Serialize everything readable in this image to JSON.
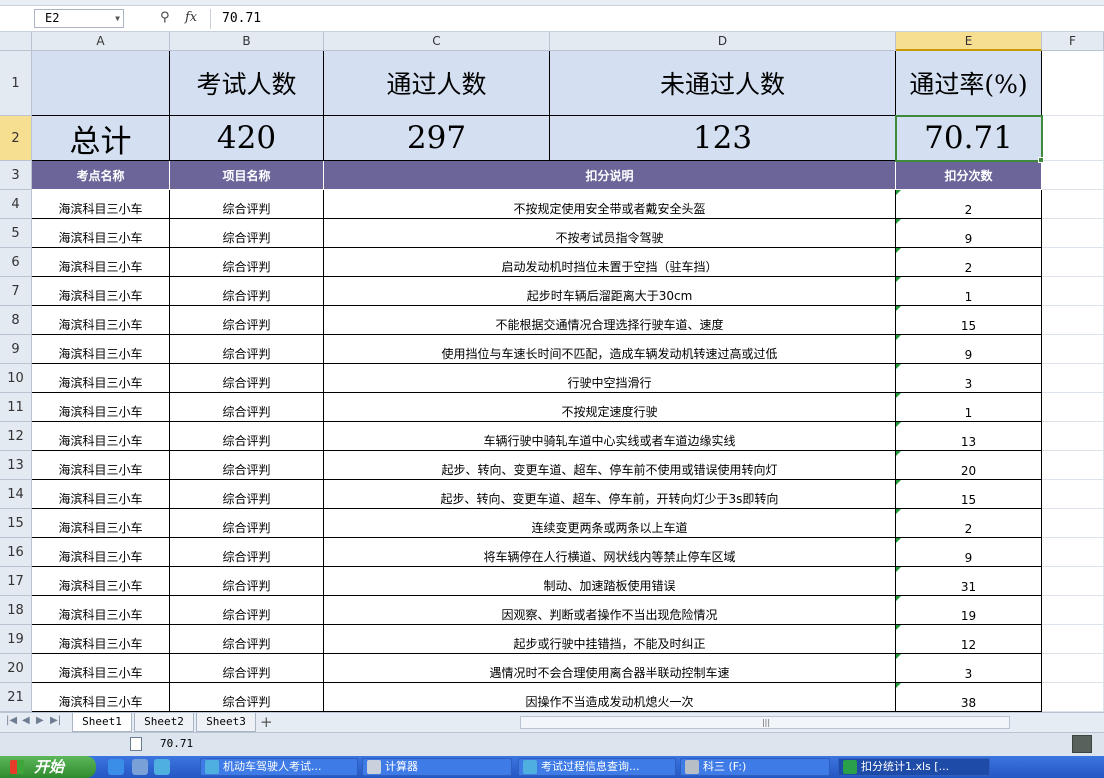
{
  "formula_bar": {
    "name_box": "E2",
    "fx_label": "fx",
    "formula_value": "70.71"
  },
  "columns": [
    "A",
    "B",
    "C",
    "D",
    "E",
    "F"
  ],
  "row_numbers": [
    "1",
    "2",
    "3",
    "4",
    "5",
    "6",
    "7",
    "8",
    "9",
    "10",
    "11",
    "12",
    "13",
    "14",
    "15",
    "16",
    "17",
    "18",
    "19",
    "20",
    "21"
  ],
  "summary": {
    "headers": [
      "",
      "考试人数",
      "通过人数",
      "未通过人数",
      "通过率(%)"
    ],
    "values": [
      "总计",
      "420",
      "297",
      "123",
      "70.71"
    ]
  },
  "table": {
    "headers": [
      "考点名称",
      "项目名称",
      "扣分说明",
      "扣分次数"
    ],
    "rows": [
      [
        "海滨科目三小车",
        "综合评判",
        "不按规定使用安全带或者戴安全头盔",
        "2"
      ],
      [
        "海滨科目三小车",
        "综合评判",
        "不按考试员指令驾驶",
        "9"
      ],
      [
        "海滨科目三小车",
        "综合评判",
        "启动发动机时挡位未置于空挡（驻车挡）",
        "2"
      ],
      [
        "海滨科目三小车",
        "综合评判",
        "起步时车辆后溜距离大于30cm",
        "1"
      ],
      [
        "海滨科目三小车",
        "综合评判",
        "不能根据交通情况合理选择行驶车道、速度",
        "15"
      ],
      [
        "海滨科目三小车",
        "综合评判",
        "使用挡位与车速长时间不匹配，造成车辆发动机转速过高或过低",
        "9"
      ],
      [
        "海滨科目三小车",
        "综合评判",
        "行驶中空挡滑行",
        "3"
      ],
      [
        "海滨科目三小车",
        "综合评判",
        "不按规定速度行驶",
        "1"
      ],
      [
        "海滨科目三小车",
        "综合评判",
        "车辆行驶中骑轧车道中心实线或者车道边缘实线",
        "13"
      ],
      [
        "海滨科目三小车",
        "综合评判",
        "起步、转向、变更车道、超车、停车前不使用或错误使用转向灯",
        "20"
      ],
      [
        "海滨科目三小车",
        "综合评判",
        "起步、转向、变更车道、超车、停车前，开转向灯少于3s即转向",
        "15"
      ],
      [
        "海滨科目三小车",
        "综合评判",
        "连续变更两条或两条以上车道",
        "2"
      ],
      [
        "海滨科目三小车",
        "综合评判",
        "将车辆停在人行横道、网状线内等禁止停车区域",
        "9"
      ],
      [
        "海滨科目三小车",
        "综合评判",
        "制动、加速踏板使用错误",
        "31"
      ],
      [
        "海滨科目三小车",
        "综合评判",
        "因观察、判断或者操作不当出现危险情况",
        "19"
      ],
      [
        "海滨科目三小车",
        "综合评判",
        "起步或行驶中挂错挡，不能及时纠正",
        "12"
      ],
      [
        "海滨科目三小车",
        "综合评判",
        "遇情况时不会合理使用离合器半联动控制车速",
        "3"
      ],
      [
        "海滨科目三小车",
        "综合评判",
        "因操作不当造成发动机熄火一次",
        "38"
      ]
    ]
  },
  "sheet_tabs": [
    "Sheet1",
    "Sheet2",
    "Sheet3"
  ],
  "active_sheet": "Sheet1",
  "add_sheet": "+",
  "status_bar": {
    "value": "70.71"
  },
  "taskbar": {
    "start": "开始",
    "tasks": [
      {
        "label": "机动车驾驶人考试...",
        "icon": "browser-icon"
      },
      {
        "label": "计算器",
        "icon": "calculator-icon"
      },
      {
        "label": "考试过程信息查询...",
        "icon": "browser-icon"
      },
      {
        "label": "科三 (F:)",
        "icon": "drive-icon"
      },
      {
        "label": "扣分统计1.xls [...",
        "icon": "spreadsheet-icon"
      }
    ]
  },
  "colors": {
    "header_fill": "#d4e0f1",
    "table_header_fill": "#6b659a",
    "selection": "#3f8a3a",
    "error_marker": "#1f9a34"
  }
}
